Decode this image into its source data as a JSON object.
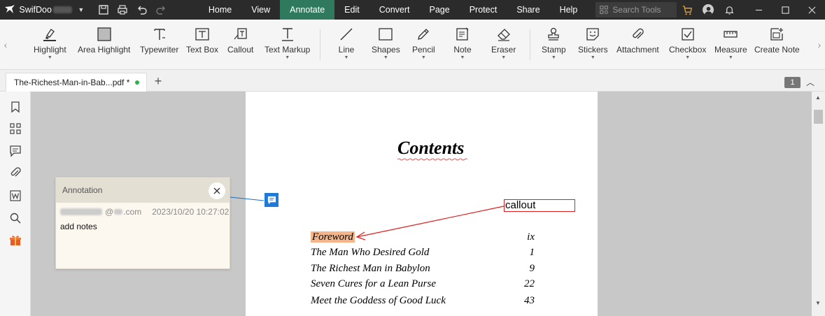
{
  "titlebar": {
    "app_name": "SwifDoo",
    "menu": [
      {
        "label": "Home"
      },
      {
        "label": "View"
      },
      {
        "label": "Annotate"
      },
      {
        "label": "Edit"
      },
      {
        "label": "Convert"
      },
      {
        "label": "Page"
      },
      {
        "label": "Protect"
      },
      {
        "label": "Share"
      },
      {
        "label": "Help"
      }
    ],
    "active_menu": "Annotate",
    "search_placeholder": "Search Tools",
    "accent_color": "#2f7a5f"
  },
  "ribbon": {
    "tools": [
      {
        "label": "Highlight",
        "icon": "highlighter-icon",
        "dropdown": true
      },
      {
        "label": "Area Highlight",
        "icon": "area-highlight-icon",
        "dropdown": false
      },
      {
        "label": "Typewriter",
        "icon": "typewriter-icon",
        "dropdown": false
      },
      {
        "label": "Text Box",
        "icon": "text-box-icon",
        "dropdown": false
      },
      {
        "label": "Callout",
        "icon": "callout-icon",
        "dropdown": false
      },
      {
        "label": "Text Markup",
        "icon": "text-markup-icon",
        "dropdown": true
      },
      {
        "label": "Line",
        "icon": "line-icon",
        "dropdown": true
      },
      {
        "label": "Shapes",
        "icon": "shapes-icon",
        "dropdown": true
      },
      {
        "label": "Pencil",
        "icon": "pencil-icon",
        "dropdown": true
      },
      {
        "label": "Note",
        "icon": "note-icon",
        "dropdown": true
      },
      {
        "label": "Eraser",
        "icon": "eraser-icon",
        "dropdown": true
      },
      {
        "label": "Stamp",
        "icon": "stamp-icon",
        "dropdown": true
      },
      {
        "label": "Stickers",
        "icon": "stickers-icon",
        "dropdown": true
      },
      {
        "label": "Attachment",
        "icon": "attachment-icon",
        "dropdown": false
      },
      {
        "label": "Checkbox",
        "icon": "checkbox-icon",
        "dropdown": true
      },
      {
        "label": "Measure",
        "icon": "measure-icon",
        "dropdown": true
      },
      {
        "label": "Create Note",
        "icon": "create-note-icon",
        "dropdown": false
      }
    ]
  },
  "tabs": {
    "document_tab": "The-Richest-Man-in-Bab...pdf *",
    "add_tab": "+",
    "page_count": "1"
  },
  "page": {
    "title": "Contents",
    "callout_text": "callout",
    "toc": [
      {
        "title": "Foreword",
        "page": "ix",
        "highlighted": true
      },
      {
        "title": "The Man Who Desired Gold",
        "page": "1"
      },
      {
        "title": "The Richest Man in Babylon",
        "page": "9"
      },
      {
        "title": "Seven Cures for a Lean Purse",
        "page": "22"
      },
      {
        "title": "Meet the Goddess of Good Luck",
        "page": "43"
      }
    ],
    "highlight_color": "#f5b58a",
    "callout_color": "#e02020",
    "note_icon_color": "#1e7ad6"
  },
  "annotation_popup": {
    "header": "Annotation",
    "author_at": "@",
    "author_domain": ".com",
    "timestamp": "2023/10/20 10:27:02",
    "text": "add notes"
  }
}
